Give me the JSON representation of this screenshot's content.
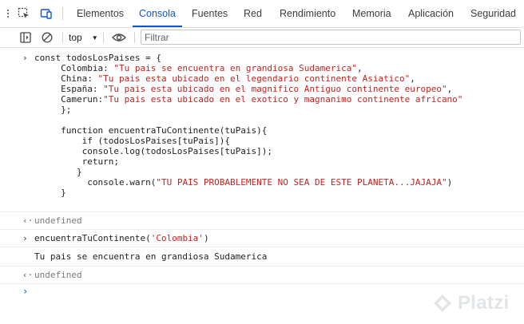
{
  "tabs": [
    {
      "label": "Elementos",
      "active": false
    },
    {
      "label": "Consola",
      "active": true
    },
    {
      "label": "Fuentes",
      "active": false
    },
    {
      "label": "Red",
      "active": false
    },
    {
      "label": "Rendimiento",
      "active": false
    },
    {
      "label": "Memoria",
      "active": false
    },
    {
      "label": "Aplicación",
      "active": false
    },
    {
      "label": "Seguridad",
      "active": false
    }
  ],
  "toolbar": {
    "context": "top",
    "filter_placeholder": "Filtrar"
  },
  "console": {
    "input1": {
      "lines": [
        "const todosLosPaises = {",
        "     Colombia: \"Tu pais se encuentra en grandiosa Sudamerica\",",
        "     China: \"Tu pais esta ubicado en el legendario continente Asiatico\",",
        "     España: \"Tu pais esta ubicado en el magnifico Antiguo continente europeo\",",
        "     Camerun:\"Tu pais esta ubicado en el exotico y magnanimo continente africano\"",
        "     };",
        "",
        "     function encuentraTuContinente(tuPais){",
        "         if (todosLosPaises[tuPais]){",
        "         console.log(todosLosPaises[tuPais]);",
        "         return;",
        "        }",
        "          console.warn(\"TU PAIS PROBABLEMENTE NO SEA DE ESTE PLANETA...JAJAJA\")",
        "     }"
      ]
    },
    "result1": "undefined",
    "input2_prefix": "encuentraTuContinente(",
    "input2_arg": "'Colombia'",
    "input2_suffix": ")",
    "log1": "Tu pais se encuentra en grandiosa Sudamerica",
    "result2": "undefined"
  },
  "watermark": "Platzi",
  "colors": {
    "accent": "#0b57d0",
    "string": "#c5221f",
    "muted": "#7a7a7a"
  }
}
